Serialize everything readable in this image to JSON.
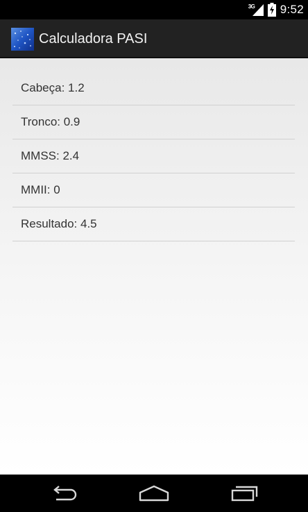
{
  "status_bar": {
    "network_type": "3G",
    "time": "9:52",
    "icons": [
      "signal-icon",
      "battery-charging-icon"
    ]
  },
  "action_bar": {
    "title": "Calculadora PASI",
    "icon": "app-launcher-icon"
  },
  "results": [
    {
      "label": "Cabeça",
      "value": "1.2",
      "text": "Cabeça: 1.2"
    },
    {
      "label": "Tronco",
      "value": "0.9",
      "text": "Tronco: 0.9"
    },
    {
      "label": "MMSS",
      "value": "2.4",
      "text": "MMSS: 2.4"
    },
    {
      "label": "MMII",
      "value": "0",
      "text": "MMII: 0"
    },
    {
      "label": "Resultado",
      "value": "4.5",
      "text": "Resultado: 4.5"
    }
  ],
  "nav_bar": {
    "buttons": [
      "back-icon",
      "home-icon",
      "recents-icon"
    ]
  },
  "colors": {
    "status_bar_bg": "#000000",
    "action_bar_bg": "#222222",
    "divider": "#d0d0d0",
    "text": "#333333",
    "nav_bar_bg": "#000000"
  }
}
